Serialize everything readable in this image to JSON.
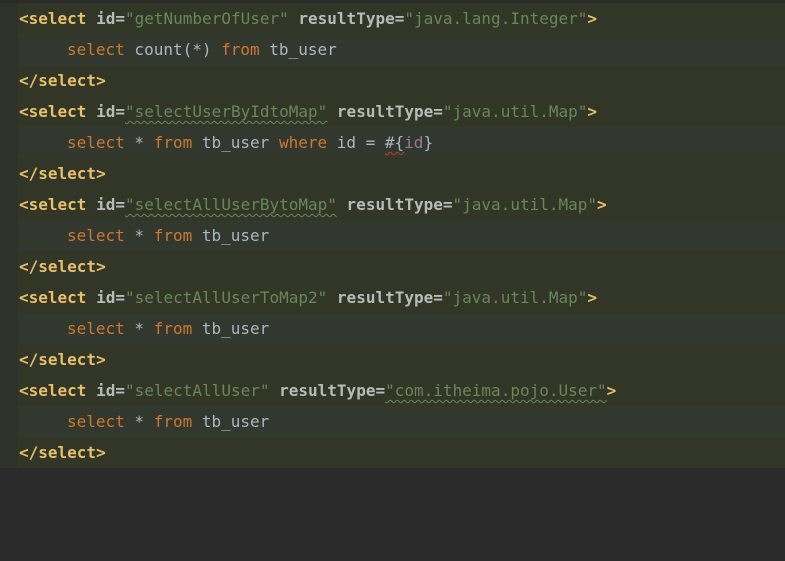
{
  "editor": {
    "lines": [
      {
        "kind": "open",
        "tag_open": "<select",
        "attr1_name": "id",
        "attr1_eq": "=",
        "attr1_value": "\"getNumberOfUser\"",
        "attr2_name": "resultType",
        "attr2_eq": "=",
        "attr2_value": "\"java.lang.Integer\"",
        "tag_close": ">"
      },
      {
        "kind": "sql",
        "text_kw1": "select",
        "text_rest1": " count(*) ",
        "text_kw2": "from",
        "text_rest2": " tb_user"
      },
      {
        "kind": "close",
        "text": "</select>"
      },
      {
        "kind": "open",
        "tag_open": "<select",
        "attr1_name": "id",
        "attr1_eq": "=",
        "attr1_value": "\"selectUserByIdtoMap\"",
        "attr2_name": "resultType",
        "attr2_eq": "=",
        "attr2_value": "\"java.util.Map\"",
        "tag_close": ">"
      },
      {
        "kind": "sql_where",
        "text_kw1": "select",
        "text_rest1": " * ",
        "text_kw2": "from",
        "text_rest2": " tb_user ",
        "text_kw3": "where",
        "text_rest3": " id = ",
        "text_hash": "#{",
        "text_param": "id",
        "text_end": "}"
      },
      {
        "kind": "close",
        "text": "</select>"
      },
      {
        "kind": "open",
        "tag_open": "<select",
        "attr1_name": "id",
        "attr1_eq": "=",
        "attr1_value": "\"selectAllUserBytoMap\"",
        "attr2_name": "resultType",
        "attr2_eq": "=",
        "attr2_value": "\"java.util.Map\"",
        "tag_close": ">"
      },
      {
        "kind": "sql",
        "text_kw1": "select",
        "text_rest1": " * ",
        "text_kw2": "from",
        "text_rest2": " tb_user"
      },
      {
        "kind": "close",
        "text": "</select>"
      },
      {
        "kind": "open",
        "tag_open": "<select",
        "attr1_name": "id",
        "attr1_eq": "=",
        "attr1_value": "\"selectAllUserToMap2\"",
        "attr2_name": "resultType",
        "attr2_eq": "=",
        "attr2_value": "\"java.util.Map\"",
        "tag_close": ">"
      },
      {
        "kind": "sql",
        "text_kw1": "select",
        "text_rest1": " * ",
        "text_kw2": "from",
        "text_rest2": " tb_user"
      },
      {
        "kind": "close",
        "text": "</select>"
      },
      {
        "kind": "open",
        "tag_open": "<select",
        "attr1_name": "id",
        "attr1_eq": "=",
        "attr1_value": "\"selectAllUser\"",
        "attr2_name": "resultType",
        "attr2_eq": "=",
        "attr2_value": "\"com.itheima.pojo.User\"",
        "tag_close": ">"
      },
      {
        "kind": "sql",
        "text_kw1": "select",
        "text_rest1": " * ",
        "text_kw2": "from",
        "text_rest2": " tb_user"
      },
      {
        "kind": "close",
        "text": "</select>"
      }
    ]
  },
  "colors": {
    "background": "#2b2b2b",
    "line_highlight": "#32382d",
    "tag": "#e8bf6a",
    "attribute": "#bababa",
    "string": "#6a8759",
    "sql_keyword": "#cc7832",
    "identifier": "#a9b7c6",
    "parameter": "#9876aa"
  }
}
